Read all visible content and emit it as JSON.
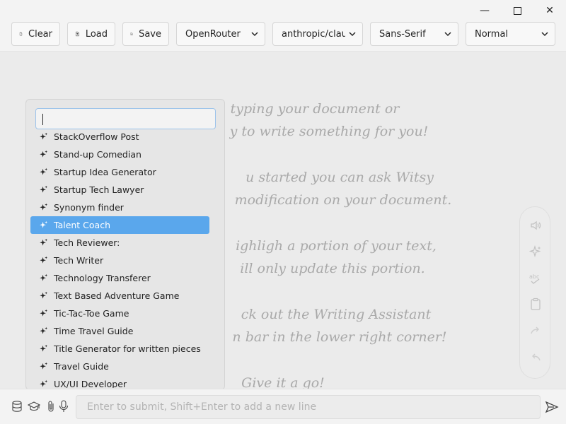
{
  "window": {
    "minimize_glyph": "—",
    "close_glyph": "✕"
  },
  "toolbar": {
    "clear_label": "Clear",
    "load_label": "Load",
    "save_label": "Save",
    "engine": "OpenRouter",
    "model": "anthropic/claude",
    "font_family": "Sans-Serif",
    "font_size": "Normal"
  },
  "document": {
    "hint_lines": [
      "typing your document or",
      "y to write something for you!",
      "u started you can ask Witsy",
      "modification on your document.",
      "ighligh a portion of your text,",
      "ill only update this portion.",
      "ck out the Writing Assistant",
      "n bar in the lower right corner!",
      "Give it a go!"
    ]
  },
  "tools": [
    "speaker-icon",
    "sparkle-icon",
    "spellcheck-icon",
    "clipboard-icon",
    "redo-icon",
    "undo-icon"
  ],
  "prompt_menu": {
    "filter_value": "",
    "items": [
      "StackOverflow Post",
      "Stand-up Comedian",
      "Startup Idea Generator",
      "Startup Tech Lawyer",
      "Synonym finder",
      "Talent Coach",
      "Tech Reviewer:",
      "Tech Writer",
      "Technology Transferer",
      "Text Based Adventure Game",
      "Tic-Tac-Toe Game",
      "Time Travel Guide",
      "Title Generator for written pieces",
      "Travel Guide",
      "UX/UI Developer"
    ],
    "selected": "Talent Coach"
  },
  "prompt_bar": {
    "placeholder": "Enter to submit, Shift+Enter to add a new line"
  },
  "colors": {
    "accent": "#5aa7ec",
    "background": "#f3f3f3",
    "document": "#ebebeb"
  }
}
